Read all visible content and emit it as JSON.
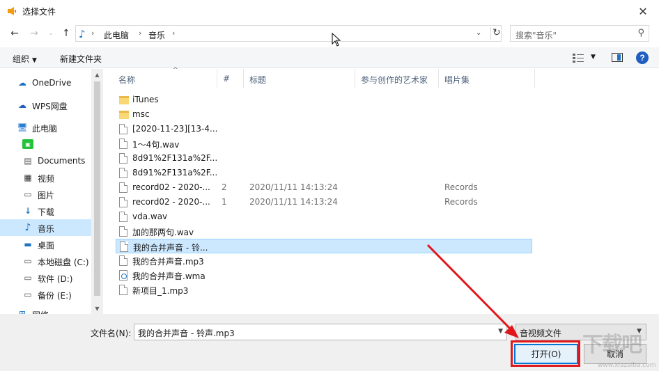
{
  "window": {
    "title": "选择文件"
  },
  "address": {
    "crumbs": [
      "此电脑",
      "音乐"
    ],
    "search_placeholder": "搜索\"音乐\""
  },
  "toolbar": {
    "organize": "组织",
    "new_folder": "新建文件夹"
  },
  "sidebar": {
    "items": [
      {
        "label": "OneDrive",
        "icon": "cloud-icon"
      },
      {
        "label": "WPS网盘",
        "icon": "wps-cloud-icon"
      },
      {
        "label": "此电脑",
        "icon": "computer-icon"
      },
      {
        "label": "",
        "icon": "wechat-folder-icon"
      },
      {
        "label": "Documents",
        "icon": "documents-icon"
      },
      {
        "label": "视频",
        "icon": "video-icon"
      },
      {
        "label": "图片",
        "icon": "picture-icon"
      },
      {
        "label": "下载",
        "icon": "download-icon"
      },
      {
        "label": "音乐",
        "icon": "music-icon",
        "selected": true
      },
      {
        "label": "桌面",
        "icon": "desktop-icon"
      },
      {
        "label": "本地磁盘 (C:)",
        "icon": "drive-icon"
      },
      {
        "label": "软件 (D:)",
        "icon": "drive-icon"
      },
      {
        "label": "备份 (E:)",
        "icon": "drive-icon"
      },
      {
        "label": "网络",
        "icon": "network-icon"
      }
    ]
  },
  "columns": [
    "名称",
    "#",
    "标题",
    "参与创作的艺术家",
    "唱片集"
  ],
  "files": [
    {
      "name": "iTunes",
      "type": "folder",
      "num": "",
      "title": "",
      "artist": "",
      "album": ""
    },
    {
      "name": "msc",
      "type": "folder",
      "num": "",
      "title": "",
      "artist": "",
      "album": ""
    },
    {
      "name": "[2020-11-23][13-4...",
      "type": "doc",
      "num": "",
      "title": "",
      "artist": "",
      "album": ""
    },
    {
      "name": "1～4句.wav",
      "type": "doc",
      "num": "",
      "title": "",
      "artist": "",
      "album": ""
    },
    {
      "name": "8d91%2F131a%2F...",
      "type": "doc",
      "num": "",
      "title": "",
      "artist": "",
      "album": ""
    },
    {
      "name": "8d91%2F131a%2F...",
      "type": "doc",
      "num": "",
      "title": "",
      "artist": "",
      "album": ""
    },
    {
      "name": "record02 - 2020-...",
      "type": "doc",
      "num": "2",
      "title": "2020/11/11 14:13:24",
      "artist": "",
      "album": "Records"
    },
    {
      "name": "record02 - 2020-...",
      "type": "doc",
      "num": "1",
      "title": "2020/11/11 14:13:24",
      "artist": "",
      "album": "Records"
    },
    {
      "name": "vda.wav",
      "type": "doc",
      "num": "",
      "title": "",
      "artist": "",
      "album": ""
    },
    {
      "name": "加的那两句.wav",
      "type": "doc",
      "num": "",
      "title": "",
      "artist": "",
      "album": ""
    },
    {
      "name": "我的合并声音 - 铃...",
      "type": "doc",
      "num": "",
      "title": "",
      "artist": "",
      "album": "",
      "selected": true
    },
    {
      "name": "我的合并声音.mp3",
      "type": "doc",
      "num": "",
      "title": "",
      "artist": "",
      "album": ""
    },
    {
      "name": "我的合并声音.wma",
      "type": "wma",
      "num": "",
      "title": "",
      "artist": "",
      "album": ""
    },
    {
      "name": "新项目_1.mp3",
      "type": "doc",
      "num": "",
      "title": "",
      "artist": "",
      "album": ""
    }
  ],
  "footer": {
    "filename_label": "文件名(N):",
    "filename_value": "我的合并声音 - 铃声.mp3",
    "filetype_value": "音视频文件",
    "open_label": "打开(O)",
    "cancel_label": "取消"
  },
  "colors": {
    "accent": "#0078d7",
    "selection": "#cce8ff",
    "annotation": "#e0161b"
  }
}
